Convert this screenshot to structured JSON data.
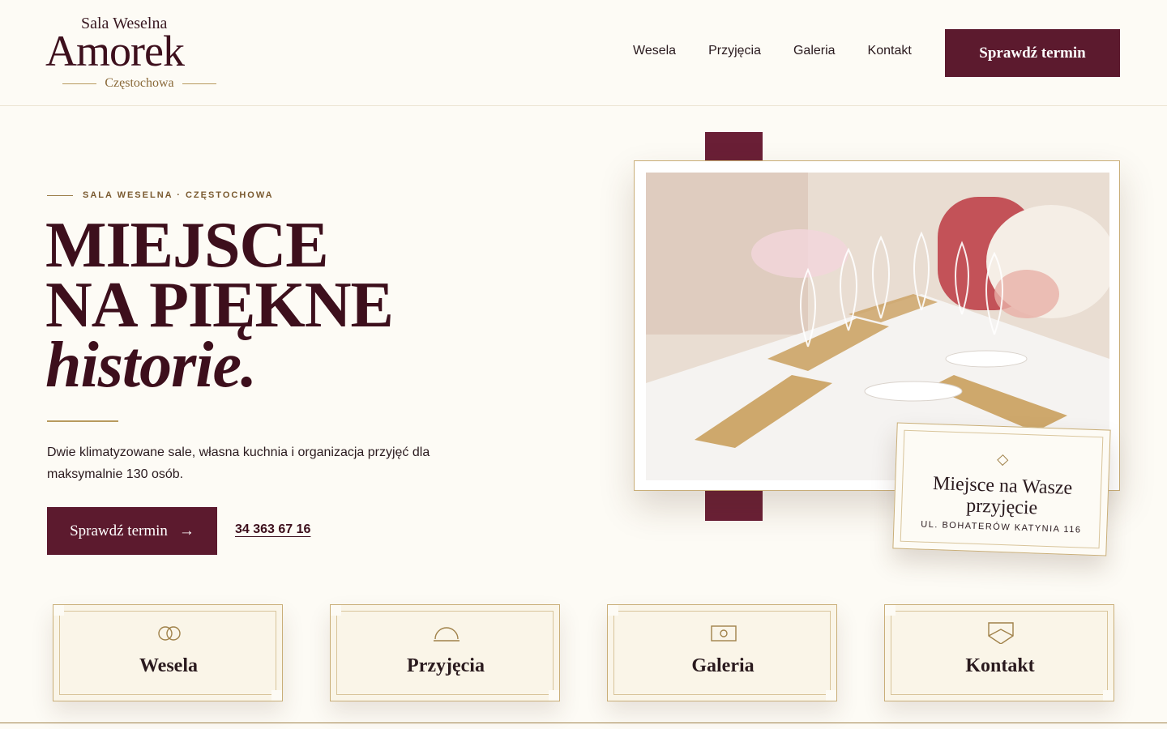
{
  "header": {
    "logo_top": "Sala Weselna",
    "logo_main": "Amorek",
    "logo_sub": "Częstochowa",
    "nav": [
      "Wesela",
      "Przyjęcia",
      "Galeria",
      "Kontakt"
    ],
    "cta": "Sprawdź termin"
  },
  "hero": {
    "eyebrow": "SALA WESELNA · CZĘSTOCHOWA",
    "title_line1": "MIEJSCE",
    "title_line2": "NA PIĘKNE",
    "title_line3": "historie.",
    "description": "Dwie klimatyzowane sale, własna kuchnia i organizacja przyjęć dla maksymalnie 130 osób.",
    "cta": "Sprawdź termin",
    "cta_arrow": "→",
    "phone": "34 363 67 16"
  },
  "plaque": {
    "title": "Miejsce na Wasze przyjęcie",
    "address": "UL. BOHATERÓW KATYNIA 116"
  },
  "cards": [
    {
      "label": "Wesela",
      "icon": "rings-icon"
    },
    {
      "label": "Przyjęcia",
      "icon": "cloche-icon"
    },
    {
      "label": "Galeria",
      "icon": "camera-icon"
    },
    {
      "label": "Kontakt",
      "icon": "envelope-icon"
    }
  ],
  "colors": {
    "accent": "#5c1a2e",
    "gold": "#b89a5e",
    "background": "#fdfbf5"
  }
}
